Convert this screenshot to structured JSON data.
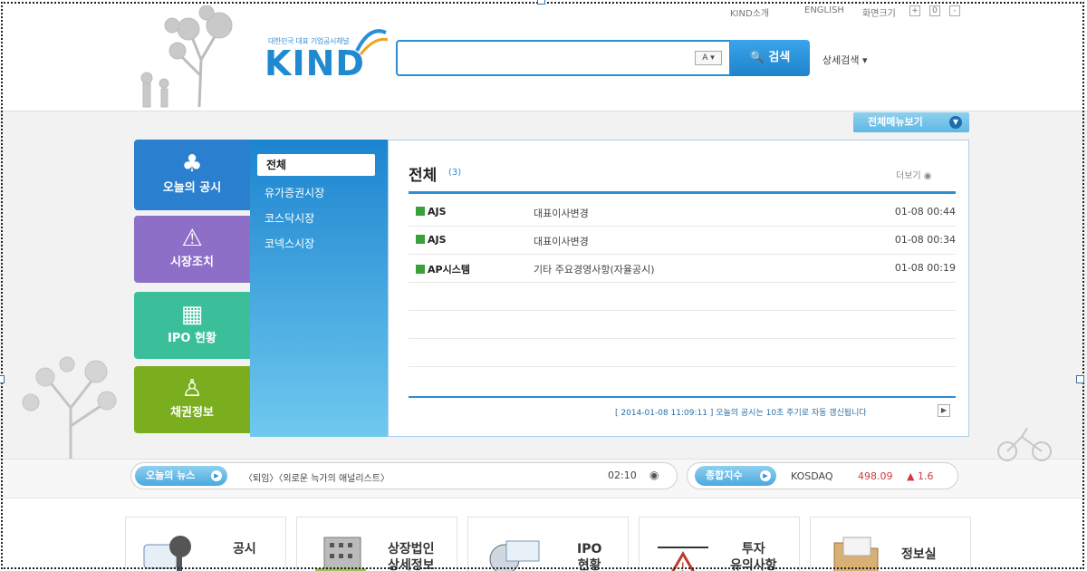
{
  "utility": {
    "kind_intro": "KIND소개",
    "english": "ENGLISH",
    "screen_size": "화면크기"
  },
  "logo": {
    "subtitle": "대한민국 대표 기업공시채널",
    "name": "KIND"
  },
  "search": {
    "value": "",
    "keyboard": "A",
    "button": "검색",
    "advanced": "상세검색"
  },
  "all_menu": "전체메뉴보기",
  "tiles": [
    {
      "label": "오늘의 공시",
      "icon": "speaker-icon",
      "color": "#2a7fcf"
    },
    {
      "label": "시장조치",
      "icon": "warning-icon",
      "color": "#8d6fc8"
    },
    {
      "label": "IPO 현황",
      "icon": "building-icon",
      "color": "#3bbf9a"
    },
    {
      "label": "채권정보",
      "icon": "stamp-icon",
      "color": "#7aae1f"
    }
  ],
  "submenu": {
    "selected": "전체",
    "items": [
      "유가증권시장",
      "코스닥시장",
      "코넥스시장"
    ]
  },
  "panel": {
    "title": "전체",
    "count": "(3)",
    "more": "더보기",
    "rows": [
      {
        "company": "AJS",
        "title": "대표이사변경",
        "time": "01-08 00:44"
      },
      {
        "company": "AJS",
        "title": "대표이사변경",
        "time": "01-08 00:34"
      },
      {
        "company": "AP시스템",
        "title": "기타 주요경영사항(자율공시)",
        "time": "01-08 00:19"
      }
    ],
    "footer": "[ 2014-01-08 11:09:11 ] 오늘의 공시는 10초 주기로 자동 갱신됩니다"
  },
  "news": {
    "label": "오늘의 뉴스",
    "headline": "〈퇴임〉〈외로운 늑가의 애널리스트〉",
    "time": "02:10"
  },
  "index": {
    "label": "종합지수",
    "name": "KOSDAQ",
    "value": "498.09",
    "change": "▲ 1.6"
  },
  "cards": [
    {
      "label": "공시",
      "icon": "megaphone-icon"
    },
    {
      "label": "상장법인\n상세정보",
      "icon": "building-icon"
    },
    {
      "label": "IPO\n현황",
      "icon": "globe-icon"
    },
    {
      "label": "투자\n유의사항",
      "icon": "warning-icon"
    },
    {
      "label": "정보실",
      "icon": "folder-icon"
    }
  ]
}
